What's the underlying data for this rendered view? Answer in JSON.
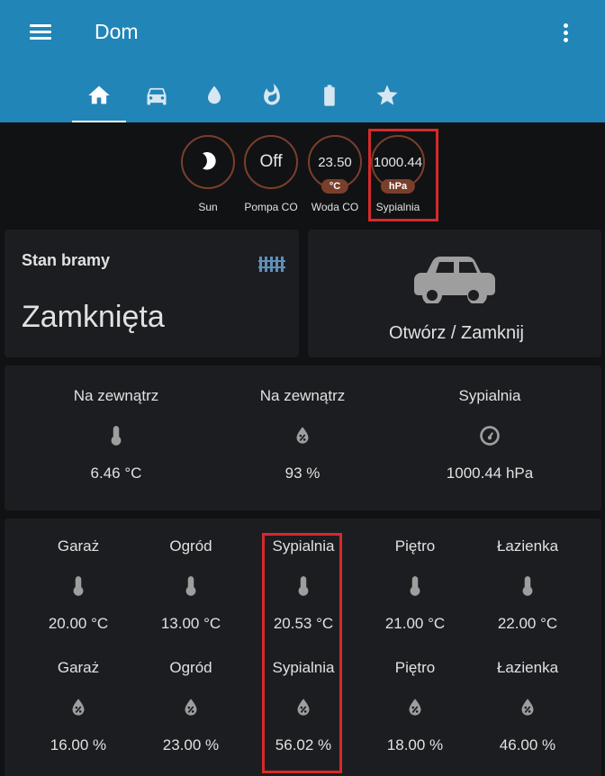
{
  "header": {
    "title": "Dom"
  },
  "tabs": [
    {
      "icon": "home-icon",
      "active": true
    },
    {
      "icon": "car-icon",
      "active": false
    },
    {
      "icon": "water-drop-icon",
      "active": false
    },
    {
      "icon": "fire-icon",
      "active": false
    },
    {
      "icon": "battery-icon",
      "active": false
    },
    {
      "icon": "star-icon",
      "active": false
    }
  ],
  "badges": [
    {
      "value": "",
      "icon": "moon-icon",
      "label": "Sun"
    },
    {
      "value": "Off",
      "label": "Pompa CO"
    },
    {
      "value": "23.50",
      "unit": "°C",
      "label": "Woda CO"
    },
    {
      "value": "1000.44",
      "unit": "hPa",
      "label": "Sypialnia"
    }
  ],
  "gate_card": {
    "title": "Stan bramy",
    "state": "Zamknięta",
    "icon": "gate-icon"
  },
  "toggle_card": {
    "name": "Otwórz / Zamknij",
    "icon": "car-icon"
  },
  "outdoor": [
    {
      "name": "Na zewnątrz",
      "icon": "thermometer-icon",
      "value": "6.46 °C"
    },
    {
      "name": "Na zewnątrz",
      "icon": "humidity-icon",
      "value": "93 %"
    },
    {
      "name": "Sypialnia",
      "icon": "gauge-icon",
      "value": "1000.44 hPa"
    }
  ],
  "rooms_temp": [
    {
      "name": "Garaż",
      "value": "20.00 °C"
    },
    {
      "name": "Ogród",
      "value": "13.00 °C"
    },
    {
      "name": "Sypialnia",
      "value": "20.53 °C"
    },
    {
      "name": "Piętro",
      "value": "21.00 °C"
    },
    {
      "name": "Łazienka",
      "value": "22.00 °C"
    }
  ],
  "rooms_humidity": [
    {
      "name": "Garaż",
      "value": "16.00 %"
    },
    {
      "name": "Ogród",
      "value": "23.00 %"
    },
    {
      "name": "Sypialnia",
      "value": "56.02 %"
    },
    {
      "name": "Piętro",
      "value": "18.00 %"
    },
    {
      "name": "Łazienka",
      "value": "46.00 %"
    }
  ],
  "colors": {
    "header": "#2185b8",
    "background": "#111214",
    "card": "#1c1d21",
    "badge_ring": "#7a3f2a",
    "highlight": "#d62a2a",
    "icon": "#9e9e9e"
  }
}
